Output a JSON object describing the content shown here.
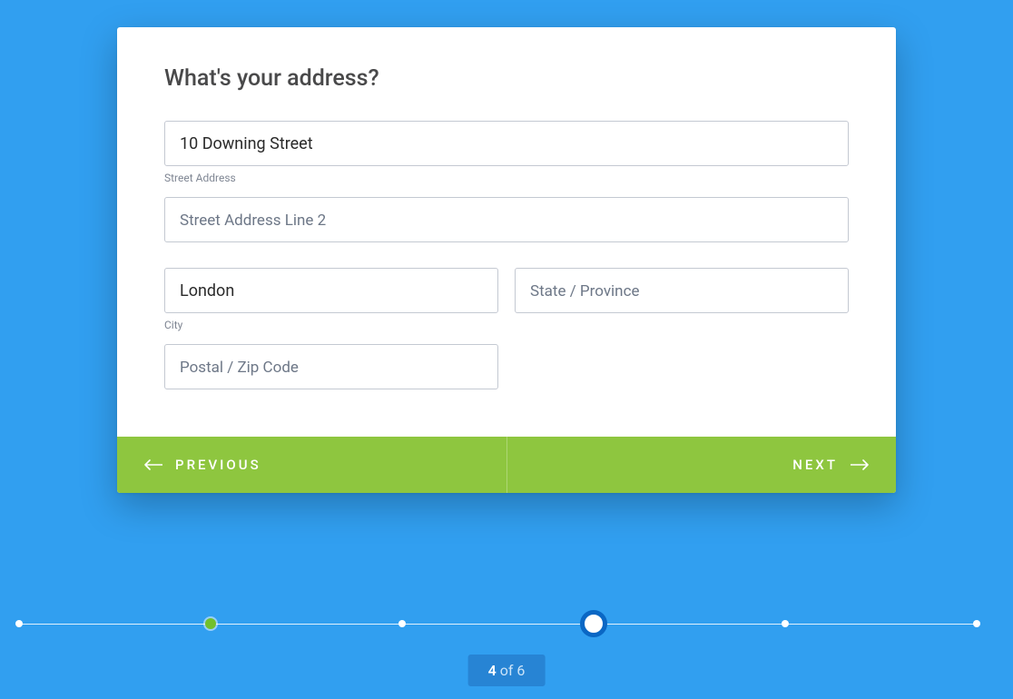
{
  "form": {
    "title": "What's your address?",
    "street1": {
      "value": "10 Downing Street",
      "placeholder": "Street Address",
      "label": "Street Address"
    },
    "street2": {
      "value": "",
      "placeholder": "Street Address Line 2"
    },
    "city": {
      "value": "London",
      "placeholder": "City",
      "label": "City"
    },
    "state": {
      "value": "",
      "placeholder": "State / Province"
    },
    "postal": {
      "value": "",
      "placeholder": "Postal / Zip Code"
    }
  },
  "nav": {
    "prev_label": "PREVIOUS",
    "next_label": "NEXT"
  },
  "progress": {
    "current": 4,
    "total": 6,
    "of_word": " of ",
    "completed_step": 2,
    "colors": {
      "accent_green": "#8ec63f",
      "background_blue": "#319ff0",
      "current_ring": "#0a67c4"
    }
  }
}
